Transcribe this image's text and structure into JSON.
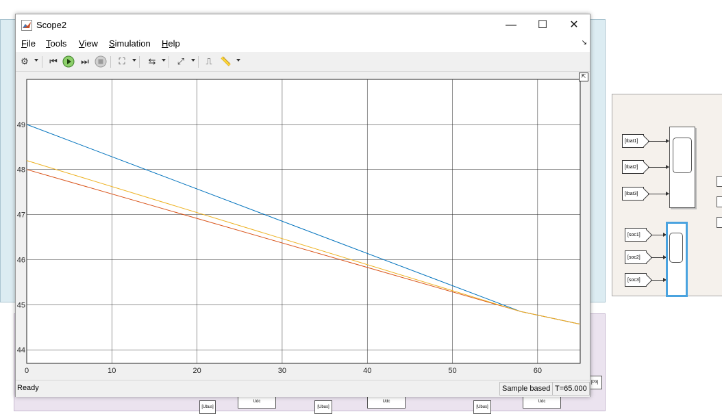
{
  "window": {
    "title": "Scope2",
    "controls": {
      "minimize": "—",
      "maximize": "☐",
      "close": "✕"
    }
  },
  "menu": {
    "items": [
      {
        "key": "F",
        "rest": "ile"
      },
      {
        "key": "T",
        "rest": "ools"
      },
      {
        "key": "V",
        "rest": "iew"
      },
      {
        "key": "S",
        "rest": "imulation"
      },
      {
        "key": "H",
        "rest": "elp"
      }
    ],
    "undock_icon": "undock-arrow-icon"
  },
  "toolbar": {
    "icons": [
      "settings-gear-icon",
      "step-back-icon",
      "run-icon",
      "step-forward-icon",
      "stop-icon",
      "highlight-block-icon",
      "zoom-icon",
      "autoscale-icon",
      "triggers-icon",
      "measurements-icon"
    ]
  },
  "status": {
    "ready": "Ready",
    "mode": "Sample based",
    "time": "T=65.000"
  },
  "colors": {
    "series1": "#0072BD",
    "series2": "#D95319",
    "series3": "#EDB120",
    "plot_bg": "#ffffff",
    "grid": "#262626"
  },
  "chart_data": {
    "type": "line",
    "title": "",
    "xlabel": "",
    "ylabel": "",
    "xlim": [
      0,
      65
    ],
    "ylim": [
      43.7,
      50.0
    ],
    "xticks": [
      0,
      10,
      20,
      30,
      40,
      50,
      60
    ],
    "yticks": [
      44,
      45,
      46,
      47,
      48,
      49
    ],
    "grid": true,
    "series": [
      {
        "x": [
          0,
          58,
          65
        ],
        "y": [
          49.0,
          44.85,
          44.57
        ],
        "color_key": "series1"
      },
      {
        "x": [
          0,
          58,
          65
        ],
        "y": [
          48.0,
          44.85,
          44.57
        ],
        "color_key": "series2"
      },
      {
        "x": [
          0,
          58,
          65
        ],
        "y": [
          48.2,
          44.85,
          44.57
        ],
        "color_key": "series3"
      }
    ]
  },
  "model": {
    "goto_tags": [
      "[Ibat1]",
      "[Ibat2]",
      "[Ibat3]",
      "[soc1]",
      "[soc2]",
      "[soc3]"
    ],
    "bottom_tags": [
      "[Ubus]",
      "Udc",
      "[Ubus]",
      "Udc",
      "[Ubus]",
      "Udc",
      "[P3]"
    ]
  }
}
